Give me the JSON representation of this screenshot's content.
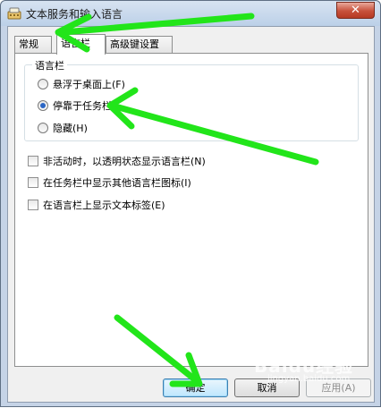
{
  "window": {
    "title": "文本服务和输入语言",
    "close_symbol": "✕"
  },
  "tabs": [
    {
      "label": "常规",
      "active": false
    },
    {
      "label": "语言栏",
      "active": true
    },
    {
      "label": "高级键设置",
      "active": false
    }
  ],
  "language_bar_group": {
    "title": "语言栏",
    "options": [
      {
        "label": "悬浮于桌面上(F)",
        "checked": false
      },
      {
        "label": "停靠于任务栏",
        "checked": true
      },
      {
        "label": "隐藏(H)",
        "checked": false
      }
    ]
  },
  "checkboxes": [
    {
      "label": "非活动时，以透明状态显示语言栏(N)",
      "checked": false
    },
    {
      "label": "在任务栏中显示其他语言栏图标(I)",
      "checked": false
    },
    {
      "label": "在语言栏上显示文本标签(E)",
      "checked": false
    }
  ],
  "buttons": {
    "ok": "确定",
    "cancel": "取消",
    "apply": "应用(A)"
  },
  "watermark": {
    "brand": "Baidu经验",
    "url": "jingyan.baidu.com"
  },
  "colors": {
    "annotation_arrow": "#22e51a",
    "radio_dot": "#2b66c4"
  },
  "icons": {
    "title": "keyboard-language-icon",
    "close": "close-icon"
  }
}
